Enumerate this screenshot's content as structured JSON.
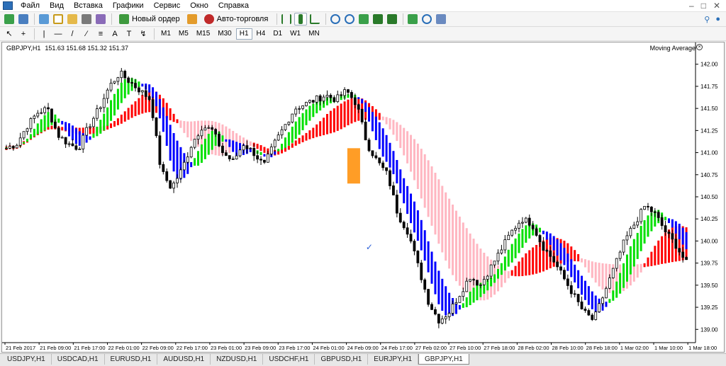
{
  "menu": {
    "items": [
      "Файл",
      "Вид",
      "Вставка",
      "Графики",
      "Сервис",
      "Окно",
      "Справка"
    ]
  },
  "toolbar": {
    "new_order_label": "Новый ордер",
    "autotrading_label": "Авто-торговля"
  },
  "timeframes": {
    "items": [
      "M1",
      "M5",
      "M15",
      "M30",
      "H1",
      "H4",
      "D1",
      "W1",
      "MN"
    ],
    "active": "H1"
  },
  "chart": {
    "symbol_header": "GBPJPY,H1",
    "ohlc_header": "151.63 151.68 151.32 151.37",
    "indicator_label": "Moving Average",
    "colors": {
      "up_fast": "#00e000",
      "down_fast": "#0000ff",
      "slow_up": "#ff0000",
      "slow_down": "#ffb6c1",
      "marker": "#ff8c00"
    }
  },
  "chart_data": {
    "type": "candlestick",
    "symbol": "GBPJPY",
    "timeframe": "H1",
    "y_ticks": [
      "142.00",
      "141.75",
      "141.50",
      "141.25",
      "141.00",
      "140.75",
      "140.50",
      "140.25",
      "140.00",
      "139.75",
      "139.50",
      "139.25",
      "139.00"
    ],
    "ylim": [
      138.85,
      142.15
    ],
    "x_ticks": [
      "21 Feb 2017",
      "21 Feb 09:00",
      "21 Feb 17:00",
      "22 Feb 01:00",
      "22 Feb 09:00",
      "22 Feb 17:00",
      "23 Feb 01:00",
      "23 Feb 09:00",
      "23 Feb 17:00",
      "24 Feb 01:00",
      "24 Feb 09:00",
      "24 Feb 17:00",
      "27 Feb 02:00",
      "27 Feb 10:00",
      "27 Feb 18:00",
      "28 Feb 02:00",
      "28 Feb 10:00",
      "28 Feb 18:00",
      "1 Mar 02:00",
      "1 Mar 10:00",
      "1 Mar 18:00"
    ],
    "close_path": [
      141.05,
      141.1,
      141.3,
      141.45,
      141.5,
      141.2,
      141.1,
      141.05,
      141.3,
      141.5,
      141.75,
      141.9,
      141.8,
      141.7,
      141.6,
      140.8,
      140.6,
      140.8,
      141.1,
      141.3,
      141.25,
      141.0,
      140.9,
      141.1,
      141.0,
      140.85,
      141.1,
      141.3,
      141.5,
      141.55,
      141.6,
      141.65,
      141.6,
      141.7,
      141.55,
      141.1,
      140.9,
      140.75,
      140.3,
      140.1,
      139.7,
      139.3,
      139.1,
      139.2,
      139.4,
      139.6,
      139.5,
      139.7,
      139.9,
      140.1,
      140.25,
      140.2,
      139.95,
      139.8,
      139.6,
      139.4,
      139.2,
      139.1,
      139.4,
      139.7,
      140.0,
      140.2,
      140.4,
      140.3,
      140.1,
      139.95,
      139.75
    ]
  },
  "tabs": {
    "items": [
      "USDJPY,H1",
      "USDCAD,H1",
      "EURUSD,H1",
      "AUDUSD,H1",
      "NZDUSD,H1",
      "USDCHF,H1",
      "GBPUSD,H1",
      "EURJPY,H1",
      "GBPJPY,H1"
    ],
    "active": "GBPJPY,H1"
  }
}
